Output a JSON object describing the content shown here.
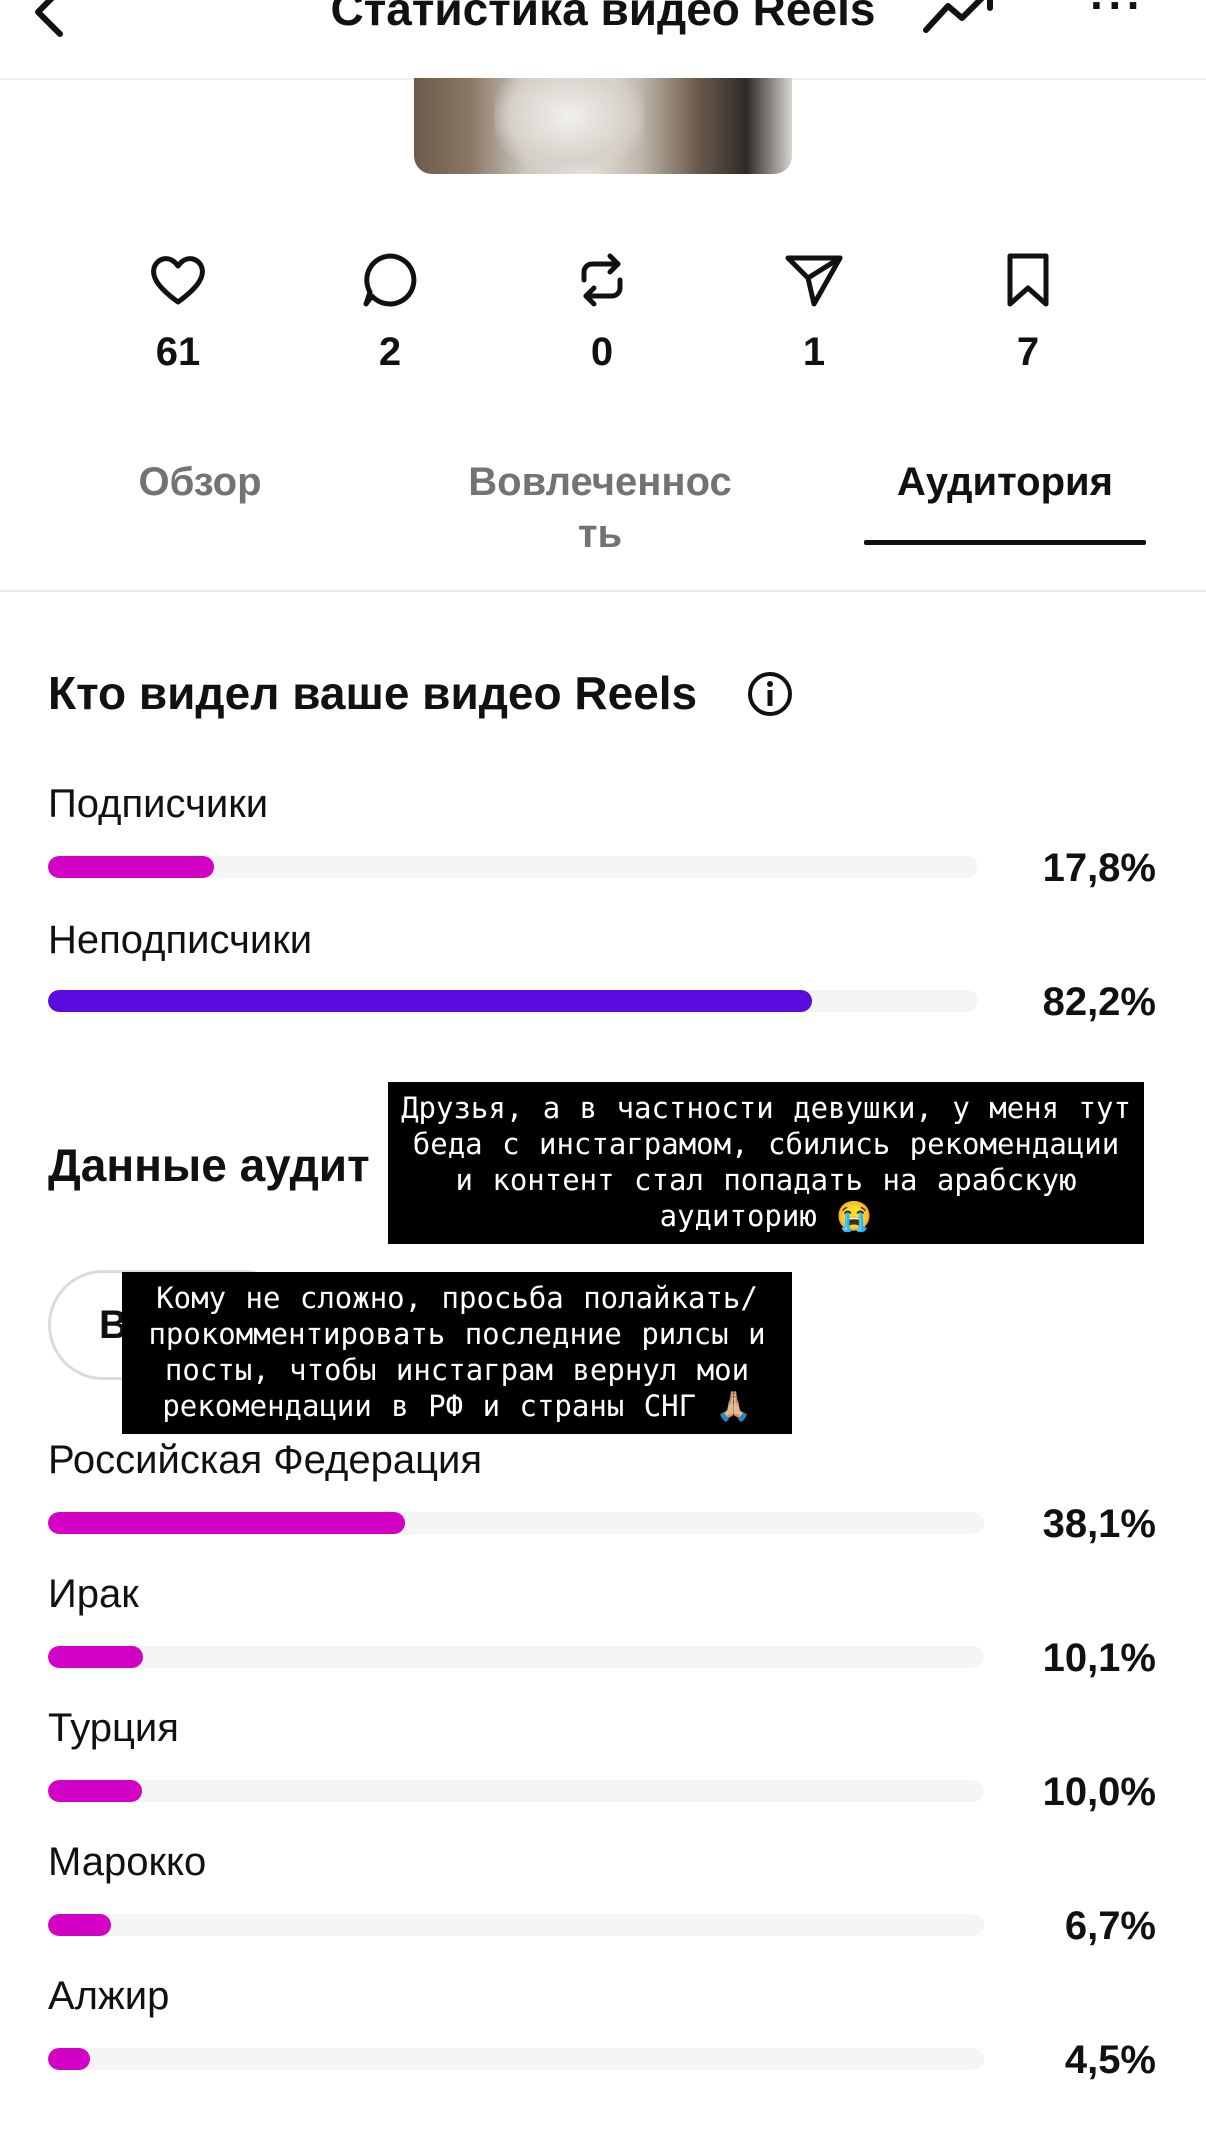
{
  "header": {
    "title": "Статистика видео Reels",
    "back_icon": "chevron-left-icon",
    "trend_icon": "trending-up-icon",
    "more_icon": "more-horizontal-icon",
    "more_label": "···"
  },
  "stats": [
    {
      "icon": "heart-icon",
      "value": "61"
    },
    {
      "icon": "comment-icon",
      "value": "2"
    },
    {
      "icon": "repost-icon",
      "value": "0"
    },
    {
      "icon": "share-icon",
      "value": "1"
    },
    {
      "icon": "bookmark-icon",
      "value": "7"
    }
  ],
  "tabs": [
    {
      "label": "Обзор",
      "active": false
    },
    {
      "label": "Вовлеченнос\nть",
      "active": false
    },
    {
      "label": "Аудитория",
      "active": true
    }
  ],
  "viewers": {
    "title": "Кто видел ваше видео Reels",
    "items": [
      {
        "label": "Подписчики",
        "value": "17,8%",
        "fraction": 0.178,
        "color": "#d300c5"
      },
      {
        "label": "Неподписчики",
        "value": "82,2%",
        "fraction": 0.822,
        "color": "#5b0bdd"
      }
    ]
  },
  "audience": {
    "title_visible": "Данные аудит",
    "filter_label_visible": "В",
    "countries": [
      {
        "label": "Российская Федерация",
        "value": "38,1%",
        "fraction": 0.381
      },
      {
        "label": "Ирак",
        "value": "10,1%",
        "fraction": 0.101
      },
      {
        "label": "Турция",
        "value": "10,0%",
        "fraction": 0.1
      },
      {
        "label": "Марокко",
        "value": "6,7%",
        "fraction": 0.067
      },
      {
        "label": "Алжир",
        "value": "4,5%",
        "fraction": 0.045
      }
    ],
    "bar_color": "#d300c5"
  },
  "captions": {
    "first": "Друзья, а в частности девушки, у меня тут беда с инстаграмом, сбились рекомендации и контент стал попадать на арабскую аудиторию 😭",
    "second": "Кому не сложно, просьба полайкать/ прокомментировать последние рилсы и посты, чтобы инстаграм вернул мои рекомендации в РФ и страны СНГ 🙏🏼"
  }
}
